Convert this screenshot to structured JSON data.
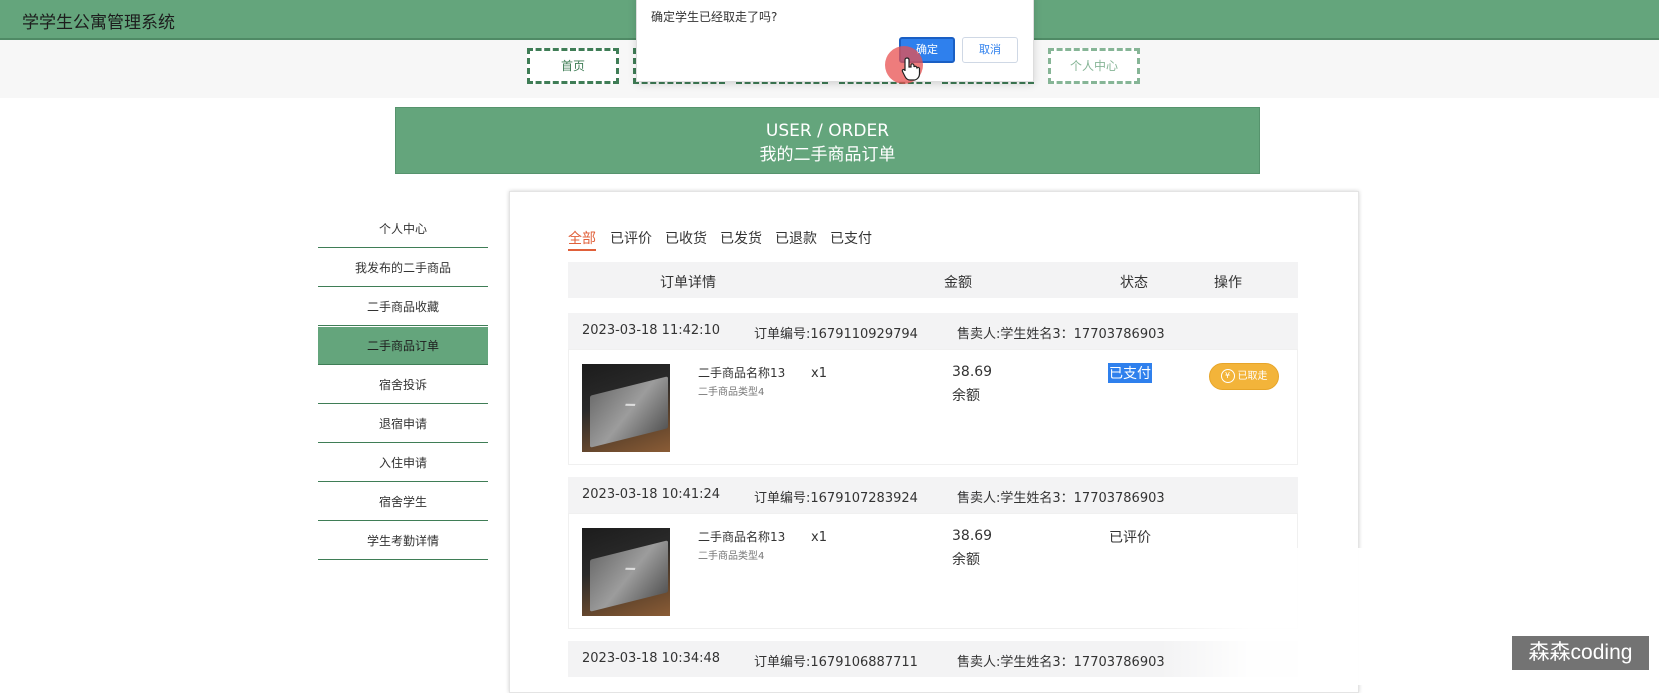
{
  "app": {
    "title": "学学生公寓管理系统"
  },
  "nav": {
    "home": "首页",
    "personal_center": "个人中心"
  },
  "dialog": {
    "message": "确定学生已经取走了吗?",
    "confirm_label": "确定",
    "cancel_label": "取消"
  },
  "banner": {
    "en_title": "USER / ORDER",
    "cn_title": "我的二手商品订单"
  },
  "sidebar": {
    "items": [
      {
        "label": "个人中心"
      },
      {
        "label": "我发布的二手商品"
      },
      {
        "label": "二手商品收藏"
      },
      {
        "label": "二手商品订单",
        "active": true
      },
      {
        "label": "宿舍投诉"
      },
      {
        "label": "退宿申请"
      },
      {
        "label": "入住申请"
      },
      {
        "label": "宿舍学生"
      },
      {
        "label": "学生考勤详情"
      }
    ]
  },
  "tabs": [
    "全部",
    "已评价",
    "已收货",
    "已发货",
    "已退款",
    "已支付"
  ],
  "table": {
    "headers": [
      "订单详情",
      "金额",
      "状态",
      "操作"
    ]
  },
  "orders": [
    {
      "datetime": "2023-03-18 11:42:10",
      "order_no": "订单编号:1679110929794",
      "seller": "售卖人:学生姓名3：17703786903",
      "product_name": "二手商品名称13",
      "product_type": "二手商品类型4",
      "qty": "x1",
      "amount": "38.69",
      "pay_type": "余额",
      "status": "已支付",
      "action_label": "已取走"
    },
    {
      "datetime": "2023-03-18 10:41:24",
      "order_no": "订单编号:1679107283924",
      "seller": "售卖人:学生姓名3：17703786903",
      "product_name": "二手商品名称13",
      "product_type": "二手商品类型4",
      "qty": "x1",
      "amount": "38.69",
      "pay_type": "余额",
      "status": "已评价"
    },
    {
      "datetime": "2023-03-18 10:34:48",
      "order_no": "订单编号:1679106887711",
      "seller": "售卖人:学生姓名3：17703786903"
    }
  ],
  "watermark": "森森coding",
  "colors": {
    "primary_green": "#64a57c",
    "dark_green": "#3f7d56",
    "accent_red": "#e0603a",
    "blue": "#2f80ed",
    "yellow": "#f3b43a"
  }
}
